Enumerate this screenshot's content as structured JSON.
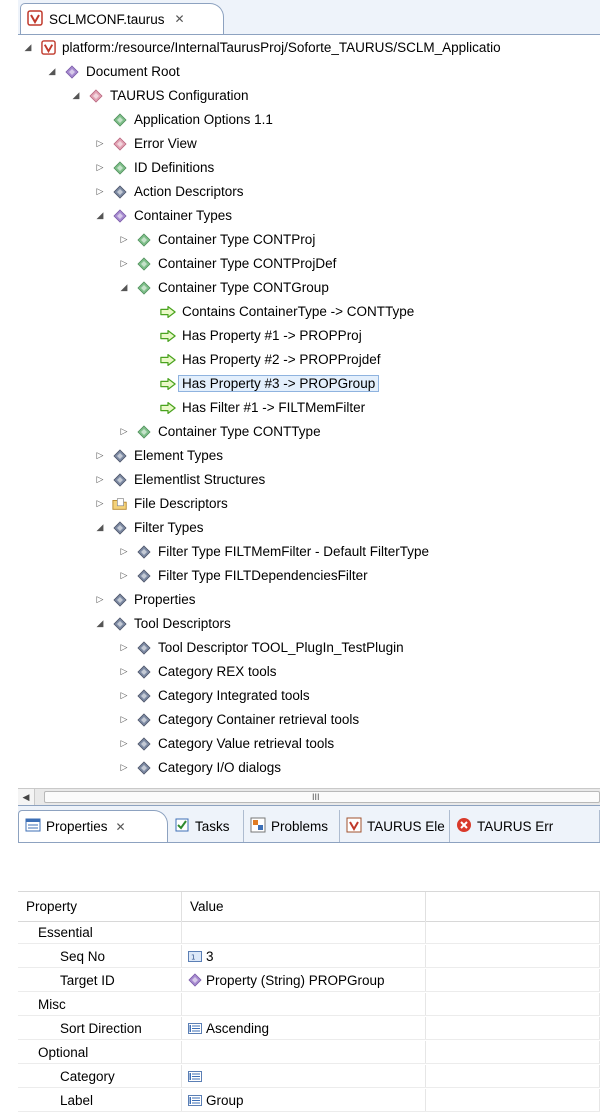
{
  "editor_tab": {
    "title": "SCLMCONF.taurus",
    "close": "✕"
  },
  "tree": [
    {
      "label": "platform:/resource/InternalTaurusProj/Soforte_TAURUS/SCLM_Applicatio",
      "level": 0,
      "twisty": "open",
      "icon": "resource-icon"
    },
    {
      "label": "Document Root",
      "level": 1,
      "twisty": "open",
      "icon": "diamond-purple-icon"
    },
    {
      "label": "TAURUS Configuration",
      "level": 2,
      "twisty": "open",
      "icon": "diamond-pink-icon"
    },
    {
      "label": "Application Options 1.1",
      "level": 3,
      "twisty": "none",
      "icon": "diamond-green-icon"
    },
    {
      "label": "Error View",
      "level": 3,
      "twisty": "closed",
      "icon": "diamond-pink-icon"
    },
    {
      "label": "ID Definitions",
      "level": 3,
      "twisty": "closed",
      "icon": "diamond-green-icon"
    },
    {
      "label": "Action Descriptors",
      "level": 3,
      "twisty": "closed",
      "icon": "diamond-dark-icon"
    },
    {
      "label": "Container Types",
      "level": 3,
      "twisty": "open",
      "icon": "diamond-purple-icon"
    },
    {
      "label": "Container Type CONTProj",
      "level": 4,
      "twisty": "closed",
      "icon": "diamond-green-icon"
    },
    {
      "label": "Container Type CONTProjDef",
      "level": 4,
      "twisty": "closed",
      "icon": "diamond-green-icon"
    },
    {
      "label": "Container Type CONTGroup",
      "level": 4,
      "twisty": "open",
      "icon": "diamond-green-icon"
    },
    {
      "label": "Contains ContainerType -> CONTType",
      "level": 5,
      "twisty": "none",
      "icon": "arrow-right-icon"
    },
    {
      "label": "Has Property #1 -> PROPProj",
      "level": 5,
      "twisty": "none",
      "icon": "arrow-right-icon"
    },
    {
      "label": "Has Property #2 -> PROPProjdef",
      "level": 5,
      "twisty": "none",
      "icon": "arrow-right-icon"
    },
    {
      "label": "Has Property #3 -> PROPGroup",
      "level": 5,
      "twisty": "none",
      "icon": "arrow-right-icon",
      "selected": true
    },
    {
      "label": "Has Filter #1 -> FILTMemFilter",
      "level": 5,
      "twisty": "none",
      "icon": "arrow-right-icon"
    },
    {
      "label": "Container Type CONTType",
      "level": 4,
      "twisty": "closed",
      "icon": "diamond-green-icon"
    },
    {
      "label": "Element Types",
      "level": 3,
      "twisty": "closed",
      "icon": "diamond-dark-icon"
    },
    {
      "label": "Elementlist Structures",
      "level": 3,
      "twisty": "closed",
      "icon": "diamond-dark-icon"
    },
    {
      "label": "File Descriptors",
      "level": 3,
      "twisty": "closed",
      "icon": "folder-file-icon"
    },
    {
      "label": "Filter Types",
      "level": 3,
      "twisty": "open",
      "icon": "diamond-dark-icon"
    },
    {
      "label": "Filter Type FILTMemFilter - Default FilterType",
      "level": 4,
      "twisty": "closed",
      "icon": "diamond-dark-icon"
    },
    {
      "label": "Filter Type FILTDependenciesFilter",
      "level": 4,
      "twisty": "closed",
      "icon": "diamond-dark-icon"
    },
    {
      "label": "Properties",
      "level": 3,
      "twisty": "closed",
      "icon": "diamond-dark-icon"
    },
    {
      "label": "Tool Descriptors",
      "level": 3,
      "twisty": "open",
      "icon": "diamond-dark-icon"
    },
    {
      "label": "Tool Descriptor TOOL_PlugIn_TestPlugin",
      "level": 4,
      "twisty": "closed",
      "icon": "diamond-dark-icon"
    },
    {
      "label": "Category REX tools",
      "level": 4,
      "twisty": "closed",
      "icon": "diamond-dark-icon"
    },
    {
      "label": "Category Integrated tools",
      "level": 4,
      "twisty": "closed",
      "icon": "diamond-dark-icon"
    },
    {
      "label": "Category Container retrieval tools",
      "level": 4,
      "twisty": "closed",
      "icon": "diamond-dark-icon"
    },
    {
      "label": "Category Value retrieval tools",
      "level": 4,
      "twisty": "closed",
      "icon": "diamond-dark-icon"
    },
    {
      "label": "Category I/O dialogs",
      "level": 4,
      "twisty": "closed",
      "icon": "diamond-dark-icon"
    }
  ],
  "scrollbar": {
    "left_arrow": "◀",
    "grip": "III"
  },
  "view_tabs": [
    {
      "label": "Properties",
      "close": "✕",
      "icon": "properties-icon",
      "active": true
    },
    {
      "label": "Tasks",
      "icon": "tasks-icon"
    },
    {
      "label": "Problems",
      "icon": "problems-icon"
    },
    {
      "label": "TAURUS Ele",
      "icon": "taurus-elements-icon"
    },
    {
      "label": "TAURUS Err",
      "icon": "taurus-errors-icon"
    }
  ],
  "properties": {
    "headers": {
      "property": "Property",
      "value": "Value"
    },
    "rows": [
      {
        "property": "Essential",
        "value": "",
        "indent": 1
      },
      {
        "property": "Seq No",
        "value": "3",
        "indent": 2,
        "icon": "number-icon"
      },
      {
        "property": "Target ID",
        "value": "Property (String) PROPGroup",
        "indent": 2,
        "icon": "diamond-purple-icon"
      },
      {
        "property": "Misc",
        "value": "",
        "indent": 1
      },
      {
        "property": "Sort Direction",
        "value": "Ascending",
        "indent": 2,
        "icon": "list-icon"
      },
      {
        "property": "Optional",
        "value": "",
        "indent": 1
      },
      {
        "property": "Category",
        "value": "",
        "indent": 2,
        "icon": "list-icon"
      },
      {
        "property": "Label",
        "value": "Group",
        "indent": 2,
        "icon": "list-icon"
      }
    ]
  }
}
